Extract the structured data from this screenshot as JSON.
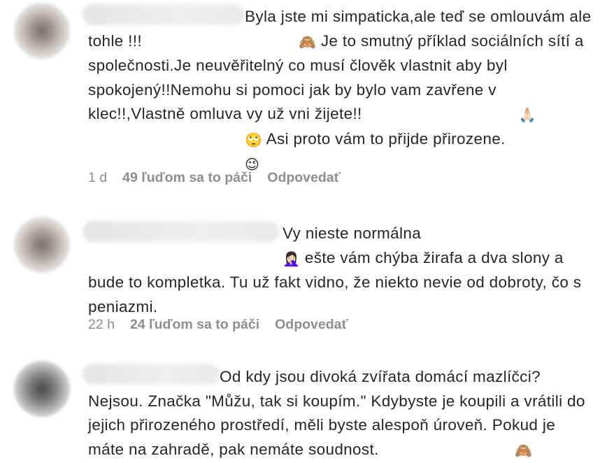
{
  "comments": [
    {
      "username_hidden": true,
      "text_parts": [
        "Byla jste mi simpaticka,ale teď se omlouvám ale tohle !!!",
        "🙈",
        " Je to smutný příklad sociálních sítí a společnosti.Je neuvěřitelný co musí člověk vlastnit aby byl spokojený!!Nemohu si pomoci jak by bylo vam zavřene v klec!!,Vlastně omluva vy už vni žijete!!",
        "🙏🏻",
        " ",
        "🙄",
        " Asi proto vám to přijde přirozene.",
        "😉"
      ],
      "time": "1 d",
      "likes": "49 ľuďom sa to páči",
      "reply": "Odpovedať"
    },
    {
      "username_hidden": true,
      "text_parts": [
        "Vy nieste normálna ",
        "🤦🏻‍♀️",
        "  ešte vám chýba žirafa a dva slony a bude to kompletka. Tu už fakt vidno, že niekto nevie od dobroty, čo s peniazmi."
      ],
      "time": "22 h",
      "likes": "24 ľuďom sa to páči",
      "reply": "Odpovedať"
    },
    {
      "username_hidden": true,
      "text_parts": [
        "Od kdy jsou divoká zvířata domácí mazlíčci? Nejsou. Značka \"Můžu, tak si koupím.\" Kdybyste je koupili a vrátili do jejich přirozeného prostředí, měli byste alespoň úroveň. Pokud je máte na zahradě, pak nemáte soudnost. ",
        "🙈"
      ]
    }
  ]
}
